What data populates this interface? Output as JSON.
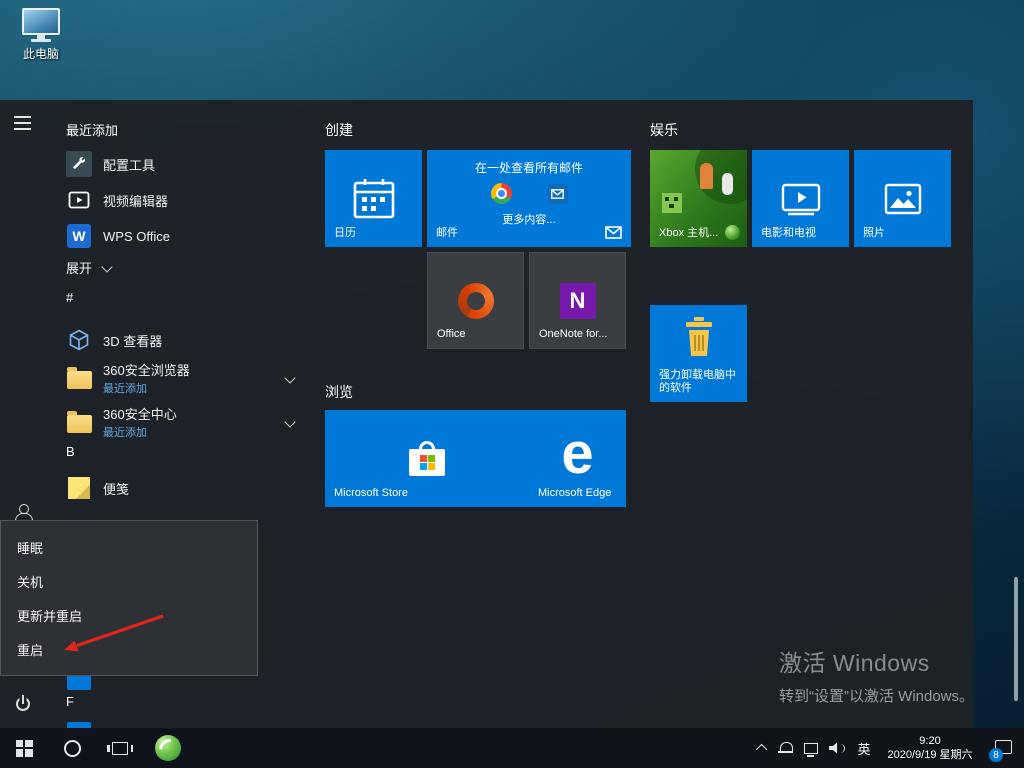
{
  "desktop": {
    "this_pc_label": "此电脑",
    "activation_line1": "激活 Windows",
    "activation_line2": "转到“设置”以激活 Windows。"
  },
  "start_menu": {
    "recent_header": "最近添加",
    "recent_items": [
      {
        "label": "配置工具"
      },
      {
        "label": "视频编辑器"
      },
      {
        "label": "WPS Office"
      }
    ],
    "expand_label": "展开",
    "sections": {
      "hash": "#",
      "b": "B",
      "f": "F"
    },
    "hash_items": [
      {
        "label": "3D 查看器"
      },
      {
        "label": "360安全浏览器",
        "sub": "最近添加"
      },
      {
        "label": "360安全中心",
        "sub": "最近添加"
      }
    ],
    "b_items": [
      {
        "label": "便笺"
      }
    ],
    "tile_groups": {
      "create": "创建",
      "browse": "浏览",
      "entertainment": "娱乐"
    },
    "tiles": {
      "calendar": "日历",
      "mail": "邮件",
      "mail_headline": "在一处查看所有邮件",
      "mail_more": "更多内容...",
      "office": "Office",
      "onenote": "OneNote for...",
      "store": "Microsoft Store",
      "edge": "Microsoft Edge",
      "edge_letter": "e",
      "onenote_letter": "N",
      "wps_letter": "W",
      "xbox": "Xbox 主机...",
      "movies": "电影和电视",
      "photos": "照片",
      "uninstall": "强力卸载电脑中的软件"
    },
    "power_menu": [
      {
        "label": "睡眠"
      },
      {
        "label": "关机"
      },
      {
        "label": "更新并重启"
      },
      {
        "label": "重启"
      }
    ]
  },
  "taskbar": {
    "ime_label": "英",
    "clock_time": "9:20",
    "clock_date": "2020/9/19 星期六",
    "notification_badge": "8"
  },
  "colors": {
    "accent": "#0078d7",
    "menu_bg": "#1e2227"
  }
}
